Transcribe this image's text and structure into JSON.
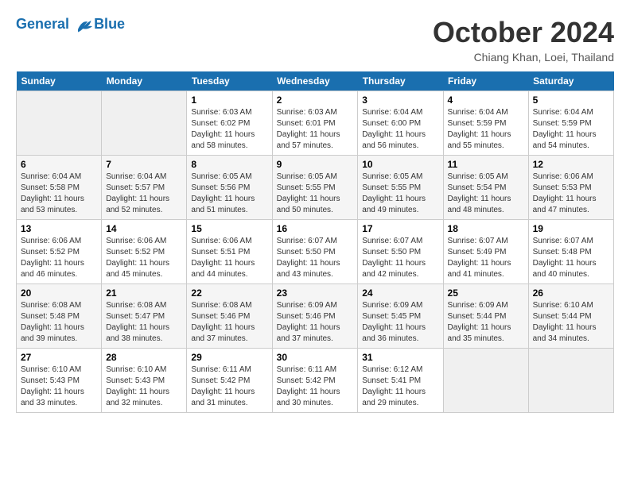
{
  "header": {
    "logo_line1": "General",
    "logo_line2": "Blue",
    "month": "October 2024",
    "location": "Chiang Khan, Loei, Thailand"
  },
  "weekdays": [
    "Sunday",
    "Monday",
    "Tuesday",
    "Wednesday",
    "Thursday",
    "Friday",
    "Saturday"
  ],
  "weeks": [
    [
      {
        "day": "",
        "empty": true
      },
      {
        "day": "",
        "empty": true
      },
      {
        "day": "1",
        "sunrise": "Sunrise: 6:03 AM",
        "sunset": "Sunset: 6:02 PM",
        "daylight": "Daylight: 11 hours and 58 minutes."
      },
      {
        "day": "2",
        "sunrise": "Sunrise: 6:03 AM",
        "sunset": "Sunset: 6:01 PM",
        "daylight": "Daylight: 11 hours and 57 minutes."
      },
      {
        "day": "3",
        "sunrise": "Sunrise: 6:04 AM",
        "sunset": "Sunset: 6:00 PM",
        "daylight": "Daylight: 11 hours and 56 minutes."
      },
      {
        "day": "4",
        "sunrise": "Sunrise: 6:04 AM",
        "sunset": "Sunset: 5:59 PM",
        "daylight": "Daylight: 11 hours and 55 minutes."
      },
      {
        "day": "5",
        "sunrise": "Sunrise: 6:04 AM",
        "sunset": "Sunset: 5:59 PM",
        "daylight": "Daylight: 11 hours and 54 minutes."
      }
    ],
    [
      {
        "day": "6",
        "sunrise": "Sunrise: 6:04 AM",
        "sunset": "Sunset: 5:58 PM",
        "daylight": "Daylight: 11 hours and 53 minutes."
      },
      {
        "day": "7",
        "sunrise": "Sunrise: 6:04 AM",
        "sunset": "Sunset: 5:57 PM",
        "daylight": "Daylight: 11 hours and 52 minutes."
      },
      {
        "day": "8",
        "sunrise": "Sunrise: 6:05 AM",
        "sunset": "Sunset: 5:56 PM",
        "daylight": "Daylight: 11 hours and 51 minutes."
      },
      {
        "day": "9",
        "sunrise": "Sunrise: 6:05 AM",
        "sunset": "Sunset: 5:55 PM",
        "daylight": "Daylight: 11 hours and 50 minutes."
      },
      {
        "day": "10",
        "sunrise": "Sunrise: 6:05 AM",
        "sunset": "Sunset: 5:55 PM",
        "daylight": "Daylight: 11 hours and 49 minutes."
      },
      {
        "day": "11",
        "sunrise": "Sunrise: 6:05 AM",
        "sunset": "Sunset: 5:54 PM",
        "daylight": "Daylight: 11 hours and 48 minutes."
      },
      {
        "day": "12",
        "sunrise": "Sunrise: 6:06 AM",
        "sunset": "Sunset: 5:53 PM",
        "daylight": "Daylight: 11 hours and 47 minutes."
      }
    ],
    [
      {
        "day": "13",
        "sunrise": "Sunrise: 6:06 AM",
        "sunset": "Sunset: 5:52 PM",
        "daylight": "Daylight: 11 hours and 46 minutes."
      },
      {
        "day": "14",
        "sunrise": "Sunrise: 6:06 AM",
        "sunset": "Sunset: 5:52 PM",
        "daylight": "Daylight: 11 hours and 45 minutes."
      },
      {
        "day": "15",
        "sunrise": "Sunrise: 6:06 AM",
        "sunset": "Sunset: 5:51 PM",
        "daylight": "Daylight: 11 hours and 44 minutes."
      },
      {
        "day": "16",
        "sunrise": "Sunrise: 6:07 AM",
        "sunset": "Sunset: 5:50 PM",
        "daylight": "Daylight: 11 hours and 43 minutes."
      },
      {
        "day": "17",
        "sunrise": "Sunrise: 6:07 AM",
        "sunset": "Sunset: 5:50 PM",
        "daylight": "Daylight: 11 hours and 42 minutes."
      },
      {
        "day": "18",
        "sunrise": "Sunrise: 6:07 AM",
        "sunset": "Sunset: 5:49 PM",
        "daylight": "Daylight: 11 hours and 41 minutes."
      },
      {
        "day": "19",
        "sunrise": "Sunrise: 6:07 AM",
        "sunset": "Sunset: 5:48 PM",
        "daylight": "Daylight: 11 hours and 40 minutes."
      }
    ],
    [
      {
        "day": "20",
        "sunrise": "Sunrise: 6:08 AM",
        "sunset": "Sunset: 5:48 PM",
        "daylight": "Daylight: 11 hours and 39 minutes."
      },
      {
        "day": "21",
        "sunrise": "Sunrise: 6:08 AM",
        "sunset": "Sunset: 5:47 PM",
        "daylight": "Daylight: 11 hours and 38 minutes."
      },
      {
        "day": "22",
        "sunrise": "Sunrise: 6:08 AM",
        "sunset": "Sunset: 5:46 PM",
        "daylight": "Daylight: 11 hours and 37 minutes."
      },
      {
        "day": "23",
        "sunrise": "Sunrise: 6:09 AM",
        "sunset": "Sunset: 5:46 PM",
        "daylight": "Daylight: 11 hours and 37 minutes."
      },
      {
        "day": "24",
        "sunrise": "Sunrise: 6:09 AM",
        "sunset": "Sunset: 5:45 PM",
        "daylight": "Daylight: 11 hours and 36 minutes."
      },
      {
        "day": "25",
        "sunrise": "Sunrise: 6:09 AM",
        "sunset": "Sunset: 5:44 PM",
        "daylight": "Daylight: 11 hours and 35 minutes."
      },
      {
        "day": "26",
        "sunrise": "Sunrise: 6:10 AM",
        "sunset": "Sunset: 5:44 PM",
        "daylight": "Daylight: 11 hours and 34 minutes."
      }
    ],
    [
      {
        "day": "27",
        "sunrise": "Sunrise: 6:10 AM",
        "sunset": "Sunset: 5:43 PM",
        "daylight": "Daylight: 11 hours and 33 minutes."
      },
      {
        "day": "28",
        "sunrise": "Sunrise: 6:10 AM",
        "sunset": "Sunset: 5:43 PM",
        "daylight": "Daylight: 11 hours and 32 minutes."
      },
      {
        "day": "29",
        "sunrise": "Sunrise: 6:11 AM",
        "sunset": "Sunset: 5:42 PM",
        "daylight": "Daylight: 11 hours and 31 minutes."
      },
      {
        "day": "30",
        "sunrise": "Sunrise: 6:11 AM",
        "sunset": "Sunset: 5:42 PM",
        "daylight": "Daylight: 11 hours and 30 minutes."
      },
      {
        "day": "31",
        "sunrise": "Sunrise: 6:12 AM",
        "sunset": "Sunset: 5:41 PM",
        "daylight": "Daylight: 11 hours and 29 minutes."
      },
      {
        "day": "",
        "empty": true
      },
      {
        "day": "",
        "empty": true
      }
    ]
  ]
}
